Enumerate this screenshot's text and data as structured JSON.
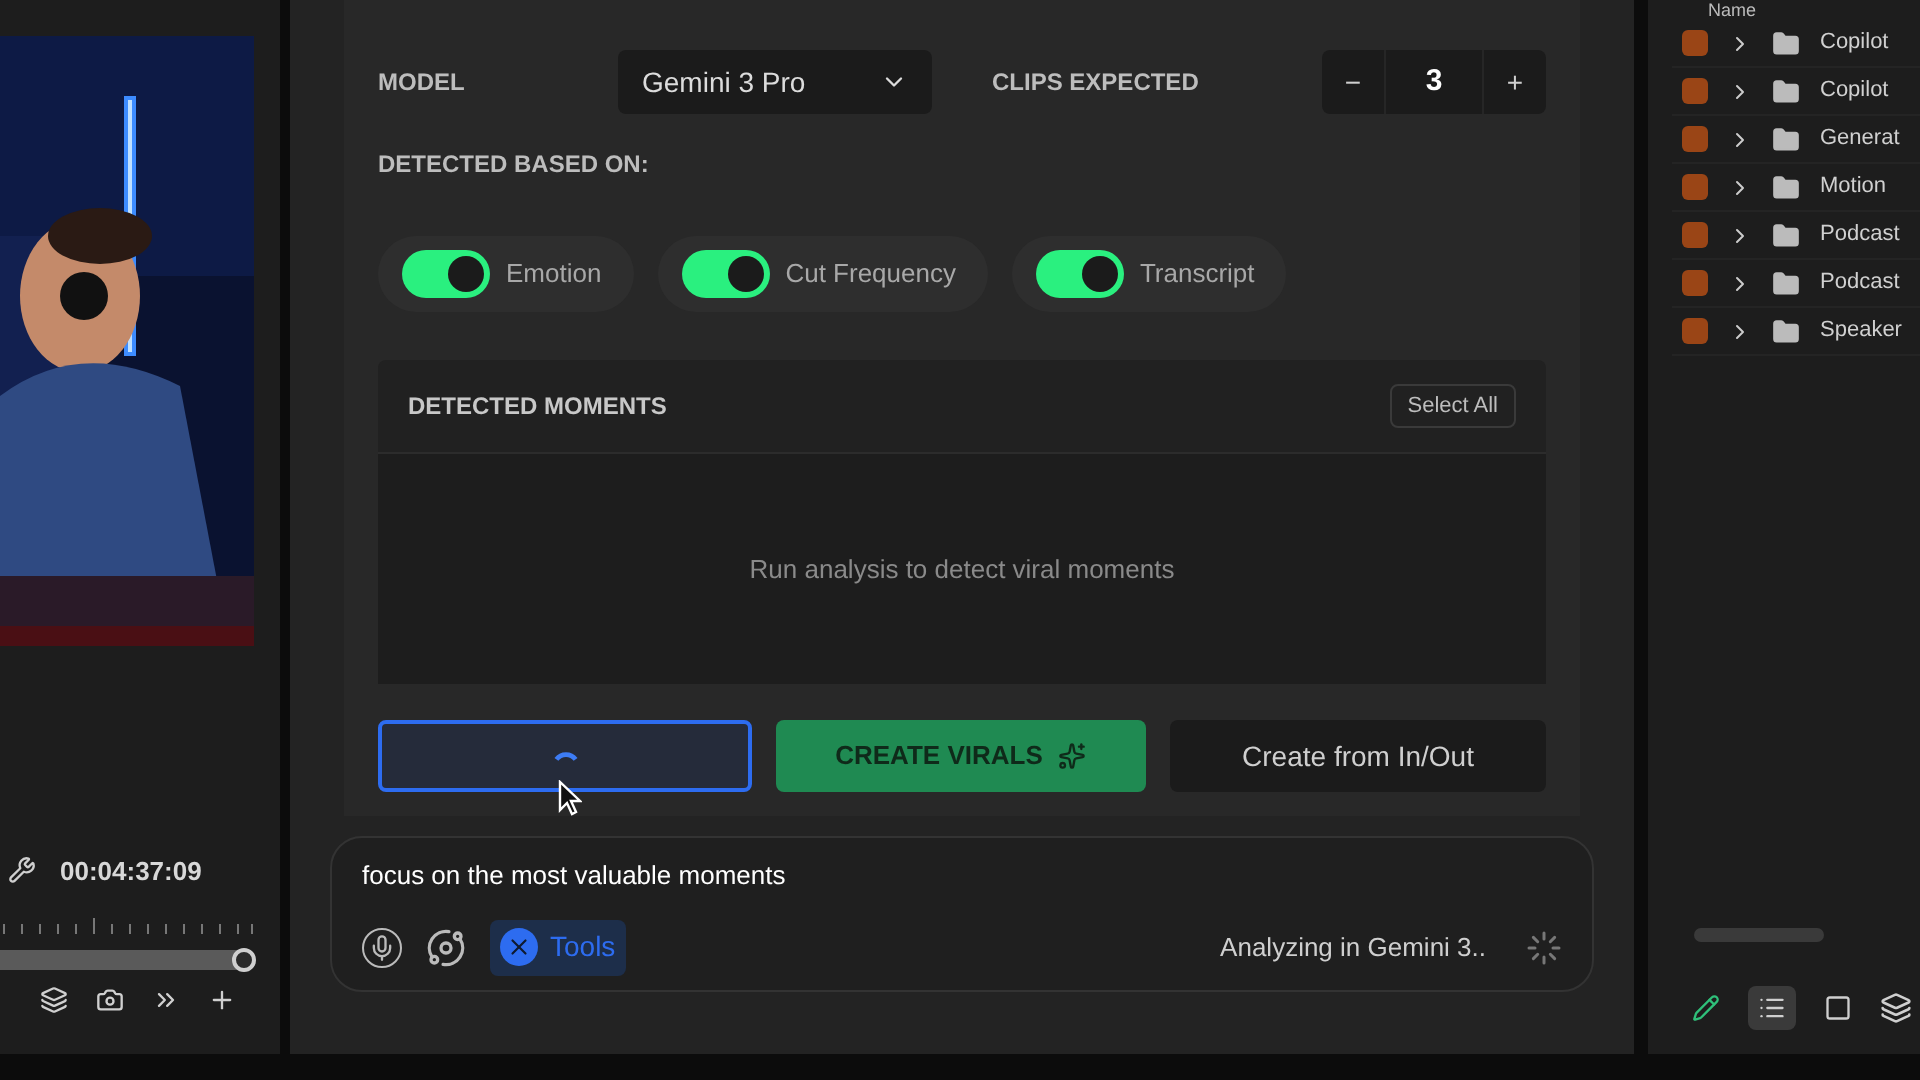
{
  "monitor": {
    "timecode": "00:04:37:09"
  },
  "settings": {
    "model_label": "MODEL",
    "model_value": "Gemini 3 Pro",
    "clips_label": "CLIPS EXPECTED",
    "clips_value": "3",
    "decrement": "−",
    "increment": "+",
    "detected_label": "DETECTED BASED ON:",
    "toggles": [
      {
        "label": "Emotion",
        "on": true
      },
      {
        "label": "Cut Frequency",
        "on": true
      },
      {
        "label": "Transcript",
        "on": true
      }
    ]
  },
  "moments": {
    "title": "DETECTED MOMENTS",
    "select_all": "Select All",
    "empty": "Run analysis to detect viral moments"
  },
  "actions": {
    "analyze_loading": true,
    "create_virals": "CREATE VIRALS",
    "create_inout": "Create from In/Out"
  },
  "prompt": {
    "value": "focus on the most valuable moments",
    "tools": "Tools",
    "status": "Analyzing in Gemini 3.."
  },
  "project": {
    "column": "Name",
    "items": [
      {
        "label": "Copilot"
      },
      {
        "label": "Copilot"
      },
      {
        "label": "Generat"
      },
      {
        "label": "Motion"
      },
      {
        "label": "Podcast"
      },
      {
        "label": "Podcast"
      },
      {
        "label": "Speaker"
      }
    ]
  }
}
